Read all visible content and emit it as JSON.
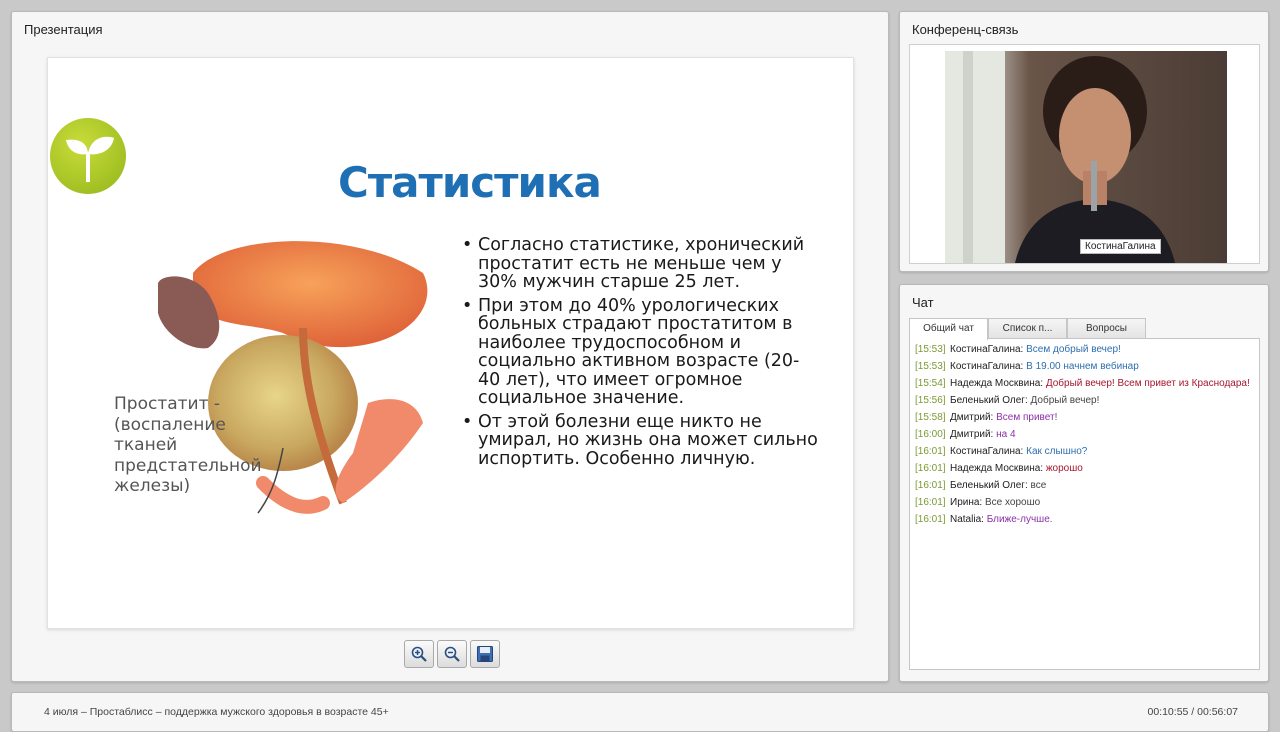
{
  "presentation": {
    "title": "Презентация",
    "slide": {
      "heading": "Статистика",
      "bullets": [
        "Согласно статистике, хронический простатит есть не меньше чем у 30% мужчин старше 25 лет.",
        "При этом до 40% урологических больных страдают простатитом в наиболее трудоспособном и социально активном возрасте (20-40 лет), что имеет огромное социальное значение.",
        "От этой болезни еще никто не умирал, но жизнь она может сильно испортить. Особенно личную."
      ],
      "caption": "Простатит - (воспаление тканей предстательной железы)"
    },
    "toolbar": {
      "zoom_in_icon": "zoom-in-icon",
      "zoom_out_icon": "zoom-out-icon",
      "save_icon": "floppy-disk-icon"
    }
  },
  "conference": {
    "title": "Конференц-связь",
    "participant_name": "КостинаГалина"
  },
  "chat": {
    "title": "Чат",
    "tabs": [
      "Общий чат",
      "Список п...",
      "Вопросы"
    ],
    "messages": [
      {
        "time": "[15:53]",
        "author": "КостинаГалина:",
        "text": "Всем добрый вечер!",
        "color": "#2e6fb0"
      },
      {
        "time": "[15:53]",
        "author": "КостинаГалина:",
        "text": "В 19.00 начнем вебинар",
        "color": "#2e6fb0"
      },
      {
        "time": "[15:54]",
        "author": "Надежда Москвина:",
        "text": "Добрый вечер! Всем привет из Краснодара!",
        "color": "#a3182c"
      },
      {
        "time": "[15:56]",
        "author": "Беленький Олег:",
        "text": "Добрый вечер!",
        "color": "#444444"
      },
      {
        "time": "[15:58]",
        "author": "Дмитрий:",
        "text": "Всем привет!",
        "color": "#8b2fa8"
      },
      {
        "time": "[16:00]",
        "author": "Дмитрий:",
        "text": "на 4",
        "color": "#8b2fa8"
      },
      {
        "time": "[16:01]",
        "author": "КостинаГалина:",
        "text": "Как слышно?",
        "color": "#2e6fb0"
      },
      {
        "time": "[16:01]",
        "author": "Надежда Москвина:",
        "text": "жорошо",
        "color": "#a3182c"
      },
      {
        "time": "[16:01]",
        "author": "Беленький Олег:",
        "text": "все",
        "color": "#444444"
      },
      {
        "time": "[16:01]",
        "author": "Ирина:",
        "text": "Все хорошо",
        "color": "#444444"
      },
      {
        "time": "[16:01]",
        "author": "Natalia:",
        "text": "Ближе-лучше.",
        "color": "#8b2fa8"
      }
    ]
  },
  "footer": {
    "title": "4 июля – Простаблисс – поддержка мужского здоровья в возрасте 45+",
    "time": "00:10:55 / 00:56:07"
  },
  "colors": {
    "accent_blue": "#1f6fb4",
    "logo_green": "#93b51a",
    "timestamp_green": "#7a9a34"
  }
}
